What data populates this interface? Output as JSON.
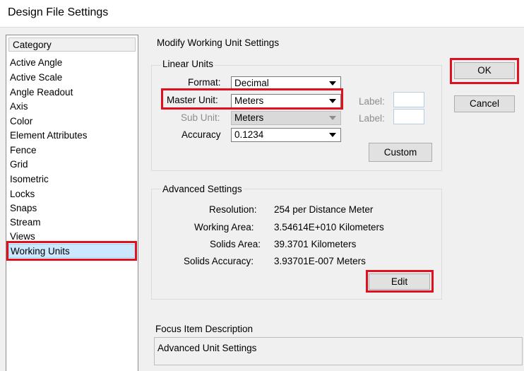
{
  "window": {
    "title": "Design File Settings"
  },
  "category": {
    "header": "Category",
    "items": [
      {
        "label": "Active Angle"
      },
      {
        "label": "Active Scale"
      },
      {
        "label": "Angle Readout"
      },
      {
        "label": "Axis"
      },
      {
        "label": "Color"
      },
      {
        "label": "Element Attributes"
      },
      {
        "label": "Fence"
      },
      {
        "label": "Grid"
      },
      {
        "label": "Isometric"
      },
      {
        "label": "Locks"
      },
      {
        "label": "Snaps"
      },
      {
        "label": "Stream"
      },
      {
        "label": "Views"
      },
      {
        "label": "Working Units"
      }
    ],
    "selected": "Working Units"
  },
  "panel": {
    "title": "Modify Working Unit Settings",
    "linear": {
      "title": "Linear Units",
      "format_label": "Format:",
      "format_value": "Decimal",
      "master_label": "Master Unit:",
      "master_value": "Meters",
      "sub_label": "Sub Unit:",
      "sub_value": "Meters",
      "accuracy_label": "Accuracy",
      "accuracy_value": "0.1234",
      "label1": "Label:",
      "label2": "Label:",
      "custom_button": "Custom"
    },
    "advanced": {
      "title": "Advanced Settings",
      "resolution_label": "Resolution:",
      "resolution_value": "254 per Distance Meter",
      "working_area_label": "Working Area:",
      "working_area_value": "3.54614E+010 Kilometers",
      "solids_area_label": "Solids Area:",
      "solids_area_value": "39.3701 Kilometers",
      "solids_accuracy_label": "Solids Accuracy:",
      "solids_accuracy_value": "3.93701E-007 Meters",
      "edit_button": "Edit"
    },
    "focus": {
      "title": "Focus Item Description",
      "text": "Advanced Unit Settings"
    }
  },
  "buttons": {
    "ok": "OK",
    "cancel": "Cancel"
  },
  "colors": {
    "highlight_red": "#e0101e",
    "selection": "#cce8ff"
  }
}
